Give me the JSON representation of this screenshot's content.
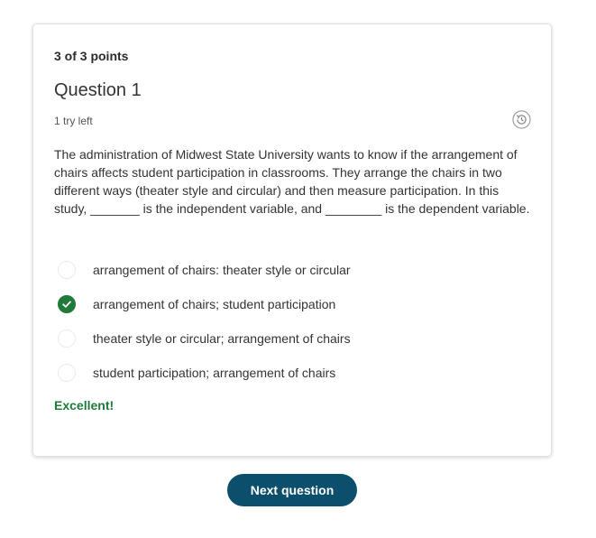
{
  "question": {
    "points": "3 of 3 points",
    "title": "Question 1",
    "tries": "1 try left",
    "prompt": "The administration of Midwest State University wants to know if the arrangement of chairs affects student participation in classrooms. They arrange the chairs in two different ways (theater style and circular) and then measure participation. In this study, _______ is the independent variable, and ________ is the dependent variable.",
    "options": [
      {
        "label": "arrangement of chairs: theater style or circular",
        "selected": false
      },
      {
        "label": "arrangement of chairs; student participation",
        "selected": true
      },
      {
        "label": "theater style or circular; arrangement of chairs",
        "selected": false
      },
      {
        "label": "student participation; arrangement of chairs",
        "selected": false
      }
    ],
    "feedback": "Excellent!",
    "history_icon": "history-icon"
  },
  "actions": {
    "next_label": "Next question"
  },
  "colors": {
    "success": "#1f7a3b",
    "primary_button": "#0b4f6c"
  }
}
